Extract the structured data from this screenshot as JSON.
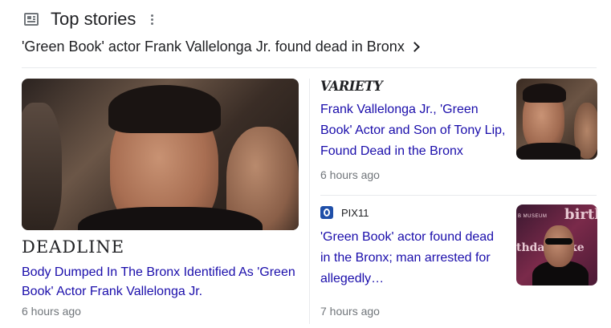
{
  "header": {
    "icon": "newspaper-icon",
    "title": "Top stories",
    "menu_icon": "more-vert-icon"
  },
  "top_story": {
    "text": "'Green Book' actor Frank Vallelonga Jr. found dead in Bronx",
    "icon": "chevron-right-icon"
  },
  "cards": [
    {
      "source": "DEADLINE",
      "headline": "Body Dumped In The Bronx Identified As 'Green Book' Actor Frank Vallelonga Jr.",
      "time": "6 hours ago"
    },
    {
      "source": "VARIETY",
      "headline": "Frank Vallelonga Jr., 'Green Book' Actor and Son of Tony Lip, Found Dead in the Bronx",
      "time": "6 hours ago"
    },
    {
      "source": "PIX11",
      "headline": "'Green Book' actor found dead in the Bronx; man arrested for allegedly…",
      "time": "7 hours ago"
    }
  ],
  "thumb_texts": {
    "museum": "B MUSEUM",
    "birthday_top": "birthd",
    "birthday_mid": "thday cake"
  },
  "colors": {
    "link": "#1a0dab",
    "meta": "#70757a",
    "text": "#202124",
    "divider": "#e8eaed"
  }
}
